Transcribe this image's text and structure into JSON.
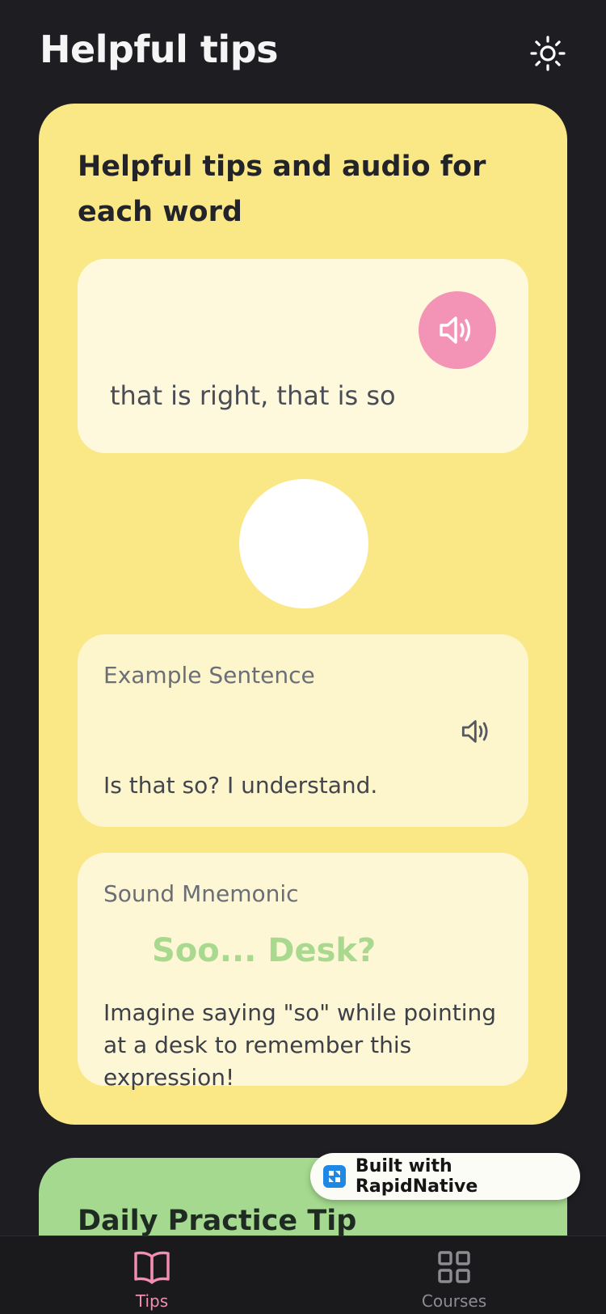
{
  "header": {
    "title": "Helpful tips",
    "theme_icon": "sun-icon"
  },
  "main_card": {
    "heading": "Helpful tips and audio for each word",
    "word_card": {
      "meaning": "that is right, that is so",
      "audio_icon": "speaker-icon"
    },
    "example": {
      "label": "Example Sentence",
      "sentence": "Is that so? I understand.",
      "audio_icon": "speaker-icon"
    },
    "mnemonic": {
      "label": "Sound Mnemonic",
      "title": "Soo... Desk?",
      "description": "Imagine saying \"so\" while pointing at a desk to remember this expression!"
    }
  },
  "tip_card": {
    "heading": "Daily Practice Tip"
  },
  "badge": {
    "label": "Built with RapidNative"
  },
  "bottom_nav": {
    "items": [
      {
        "label": "Tips",
        "icon": "book-icon",
        "active": true
      },
      {
        "label": "Courses",
        "icon": "grid-icon",
        "active": false
      }
    ]
  },
  "colors": {
    "background": "#1e1d22",
    "main_card": "#fae886",
    "accent_pink": "#f393b5",
    "mnemonic_green": "#a9d98f",
    "tip_card": "#a4d98f"
  }
}
